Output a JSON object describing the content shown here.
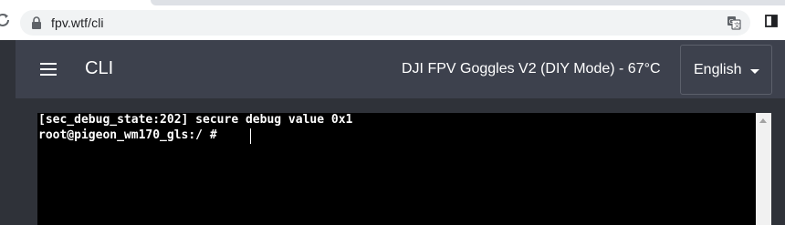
{
  "browser": {
    "url": "fpv.wtf/cli",
    "icons": [
      "reload-icon",
      "lock-icon",
      "translate-icon",
      "side-panel-icon"
    ]
  },
  "navbar": {
    "title": "CLI",
    "device_status": "DJI FPV Goggles V2 (DIY Mode) - 67°C",
    "language": "English",
    "icons": [
      "menu-icon",
      "chevron-down-icon"
    ]
  },
  "terminal": {
    "lines": [
      "[sec_debug_state:202] secure debug value 0x1",
      "root@pigeon_wm170_gls:/ # "
    ]
  },
  "colors": {
    "navbar_bg": "#3d414d",
    "page_bg": "#2f3239",
    "terminal_bg": "#000000",
    "terminal_text": "#ffffff"
  }
}
